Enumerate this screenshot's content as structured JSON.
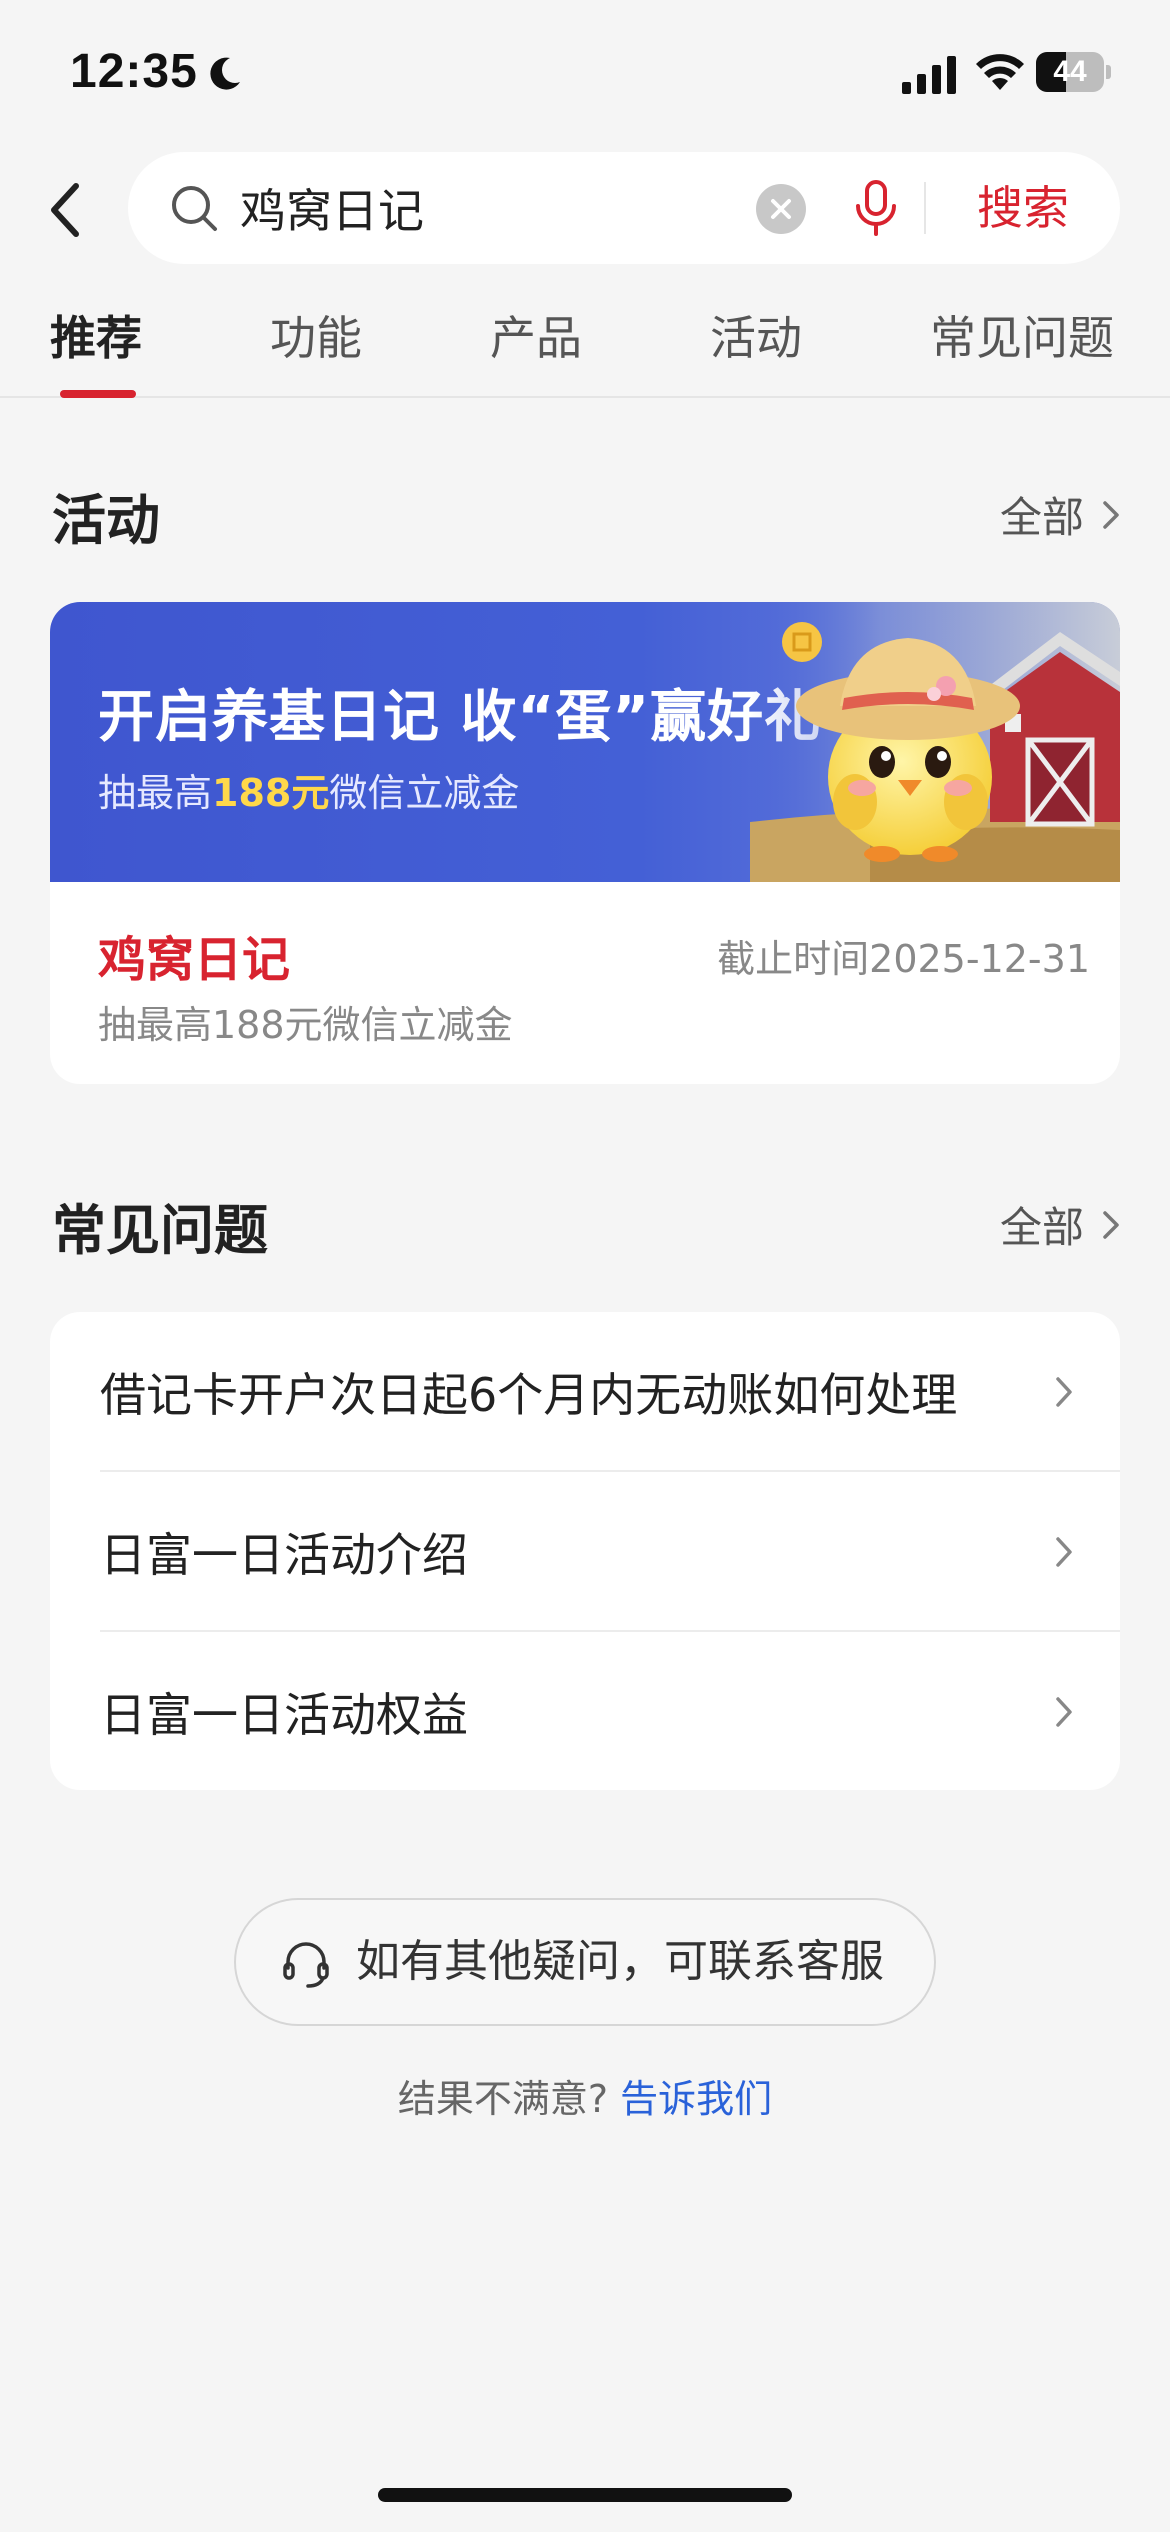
{
  "status_bar": {
    "time": "12:35",
    "battery": "44",
    "battery_level": 0.44
  },
  "search": {
    "query": "鸡窝日记",
    "button_label": "搜索"
  },
  "tabs": [
    {
      "label": "推荐",
      "active": true
    },
    {
      "label": "功能",
      "active": false
    },
    {
      "label": "产品",
      "active": false
    },
    {
      "label": "活动",
      "active": false
    },
    {
      "label": "常见问题",
      "active": false
    }
  ],
  "activity_section": {
    "title": "活动",
    "see_all": "全部",
    "banner": {
      "title": "开启养基日记 收“蛋”赢好礼",
      "sub_prefix": "抽最高",
      "sub_highlight": "188元",
      "sub_suffix": "微信立减金"
    },
    "card": {
      "title": "鸡窝日记",
      "deadline": "截止时间2025-12-31",
      "desc": "抽最高188元微信立减金"
    }
  },
  "faq_section": {
    "title": "常见问题",
    "see_all": "全部",
    "items": [
      {
        "label": "借记卡开户次日起6个月内无动账如何处理"
      },
      {
        "label": "日富一日活动介绍"
      },
      {
        "label": "日富一日活动权益"
      }
    ]
  },
  "contact": {
    "label": "如有其他疑问，可联系客服"
  },
  "feedback": {
    "prefix": "结果不满意?",
    "link": "告诉我们"
  },
  "colors": {
    "accent": "#d8232f",
    "link": "#2a62d9",
    "banner": "#4460d6",
    "highlight": "#ffd84a"
  }
}
